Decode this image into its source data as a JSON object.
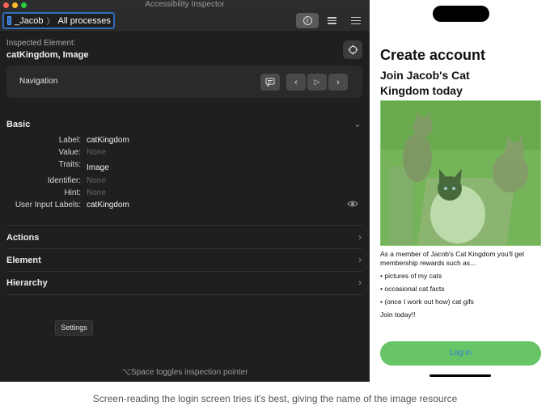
{
  "window": {
    "title": "Accessibility Inspector"
  },
  "toolbar": {
    "target": "_Jacob",
    "target_sep": "〉",
    "process": "All processes"
  },
  "inspected": {
    "label": "Inspected Element:",
    "value": "catKingdom, Image"
  },
  "navigation": {
    "label": "Navigation"
  },
  "sections": {
    "basic": "Basic",
    "actions": "Actions",
    "element": "Element",
    "hierarchy": "Hierarchy"
  },
  "properties": [
    {
      "label": "Label:",
      "value": "catKingdom",
      "dim": false
    },
    {
      "label": "Value:",
      "value": "None",
      "dim": true
    },
    {
      "label": "Traits:",
      "value": "Image",
      "dim": false
    },
    {
      "label": "Identifier:",
      "value": "None",
      "dim": true
    },
    {
      "label": "Hint:",
      "value": "None",
      "dim": true
    },
    {
      "label": "User Input Labels:",
      "value": "catKingdom",
      "dim": false
    }
  ],
  "tooltip": {
    "settings": "Settings"
  },
  "hint": "⌥Space toggles inspection pointer",
  "phone": {
    "heading": "Create account",
    "subheading": "Join Jacob's Cat Kingdom today",
    "intro_line1": "As a member of Jacob's Cat Kingdom you'll get",
    "intro_line2": "membership rewards such as...",
    "bullets": [
      "• pictures of my cats",
      "• occasional cat facts",
      "• (once I work out how) cat gifs"
    ],
    "closing": "Join today!!",
    "login_button": "Log in"
  },
  "caption": "Screen-reading the login screen tries it's best, giving the name of the image resource",
  "colors": {
    "accent": "#2f6ebd",
    "highlight": "#67c567",
    "link": "#2f7bd6"
  }
}
